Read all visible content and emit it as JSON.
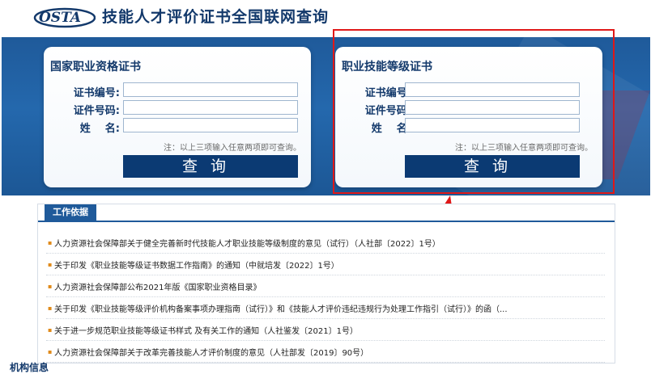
{
  "header": {
    "logo_text": "OSTA",
    "title": "技能人才评价证书全国联网查询"
  },
  "cards": [
    {
      "title": "国家职业资格证书",
      "fields": [
        {
          "label": "证书编号:",
          "value": ""
        },
        {
          "label": "证件号码:",
          "value": ""
        },
        {
          "label": "姓    名:",
          "value": ""
        }
      ],
      "note": "注：以上三项输入任意两项即可查询。",
      "button": "查询"
    },
    {
      "title": "职业技能等级证书",
      "fields": [
        {
          "label": "证书编号:",
          "value": ""
        },
        {
          "label": "证件号码:",
          "value": ""
        },
        {
          "label": "姓    名:",
          "value": ""
        }
      ],
      "note": "注：以上三项输入任意两项即可查询。",
      "button": "查询"
    }
  ],
  "panel": {
    "tab": "工作依据",
    "items": [
      "人力资源社会保障部关于健全完善新时代技能人才职业技能等级制度的意见（试行）（人社部〔2022〕1号）",
      "关于印发《职业技能等级证书数据工作指南》的通知（中就培发〔2022〕1号）",
      "人力资源社会保障部公布2021年版《国家职业资格目录》",
      "关于印发《职业技能等级评价机构备案事项办理指南（试行）》和《技能人才评价违纪违规行为处理工作指引（试行）》的函（...",
      "关于进一步规范职业技能等级证书样式 及有关工作的通知（人社鉴发〔2021〕1号）",
      "人力资源社会保障部关于改革完善技能人才评价制度的意见（人社部发〔2019〕90号）"
    ]
  },
  "footer": {
    "text": "机构信息"
  },
  "colors": {
    "brand": "#13396b",
    "banner": "#1f5a9a",
    "button": "#0b3a73",
    "highlight": "#e01818",
    "bullet": "#e08a1a"
  }
}
